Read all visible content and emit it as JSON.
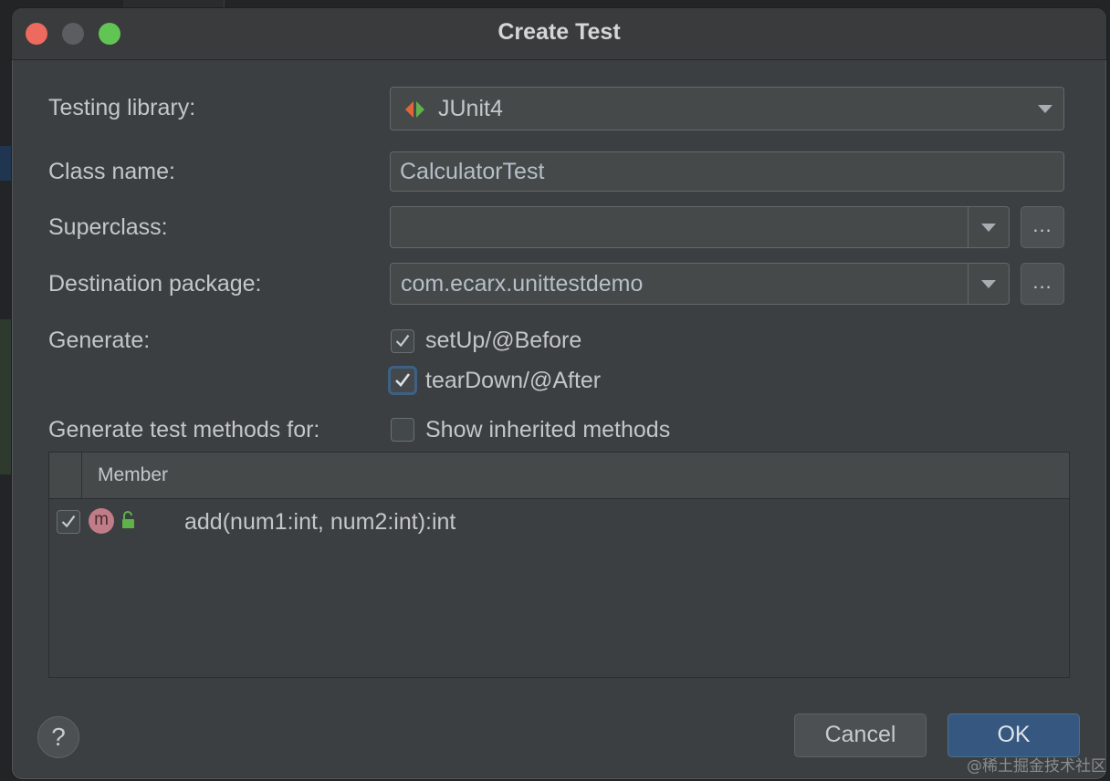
{
  "window": {
    "title": "Create Test"
  },
  "form": {
    "testing_library_label": "Testing library:",
    "testing_library_value": "JUnit4",
    "class_name_label": "Class name:",
    "class_name_value": "CalculatorTest",
    "superclass_label": "Superclass:",
    "superclass_value": "",
    "destination_package_label": "Destination package:",
    "destination_package_value": "com.ecarx.unittestdemo",
    "browse_label": "...",
    "generate_label": "Generate:",
    "generate_options": [
      {
        "label": "setUp/@Before",
        "checked": true
      },
      {
        "label": "tearDown/@After",
        "checked": true
      }
    ],
    "generate_methods_label": "Generate test methods for:",
    "show_inherited_label": "Show inherited methods",
    "show_inherited_checked": false
  },
  "members_table": {
    "header": "Member",
    "rows": [
      {
        "badge": "m",
        "signature": "add(num1:int, num2:int):int",
        "checked": true,
        "icon": "unlocked-icon"
      }
    ]
  },
  "footer": {
    "help_label": "?",
    "cancel_label": "Cancel",
    "ok_label": "OK"
  },
  "watermark": "@稀土掘金技术社区",
  "colors": {
    "dialog_bg": "#3c3f41",
    "accent_blue": "#365880",
    "close": "#ed6a5e",
    "maximize": "#61c554"
  }
}
